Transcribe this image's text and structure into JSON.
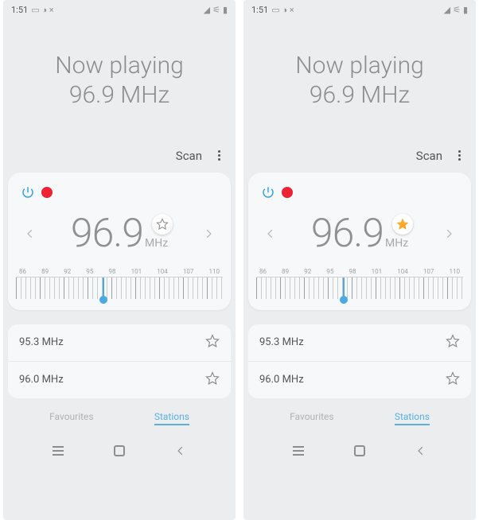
{
  "screens": [
    {
      "favourite_on": false
    },
    {
      "favourite_on": true
    }
  ],
  "status": {
    "time": "1:51"
  },
  "header": {
    "title": "Now playing",
    "subtitle": "96.9 MHz"
  },
  "toolbar": {
    "scan_label": "Scan"
  },
  "tuner": {
    "frequency": "96.9",
    "unit": "MHz",
    "dial_labels": [
      "86",
      "89",
      "92",
      "95",
      "98",
      "101",
      "104",
      "107",
      "110"
    ],
    "pointer_percent": 42
  },
  "stations": [
    {
      "label": "95.3 MHz"
    },
    {
      "label": "96.0 MHz"
    }
  ],
  "tabs": {
    "favourites": "Favourites",
    "stations": "Stations"
  }
}
